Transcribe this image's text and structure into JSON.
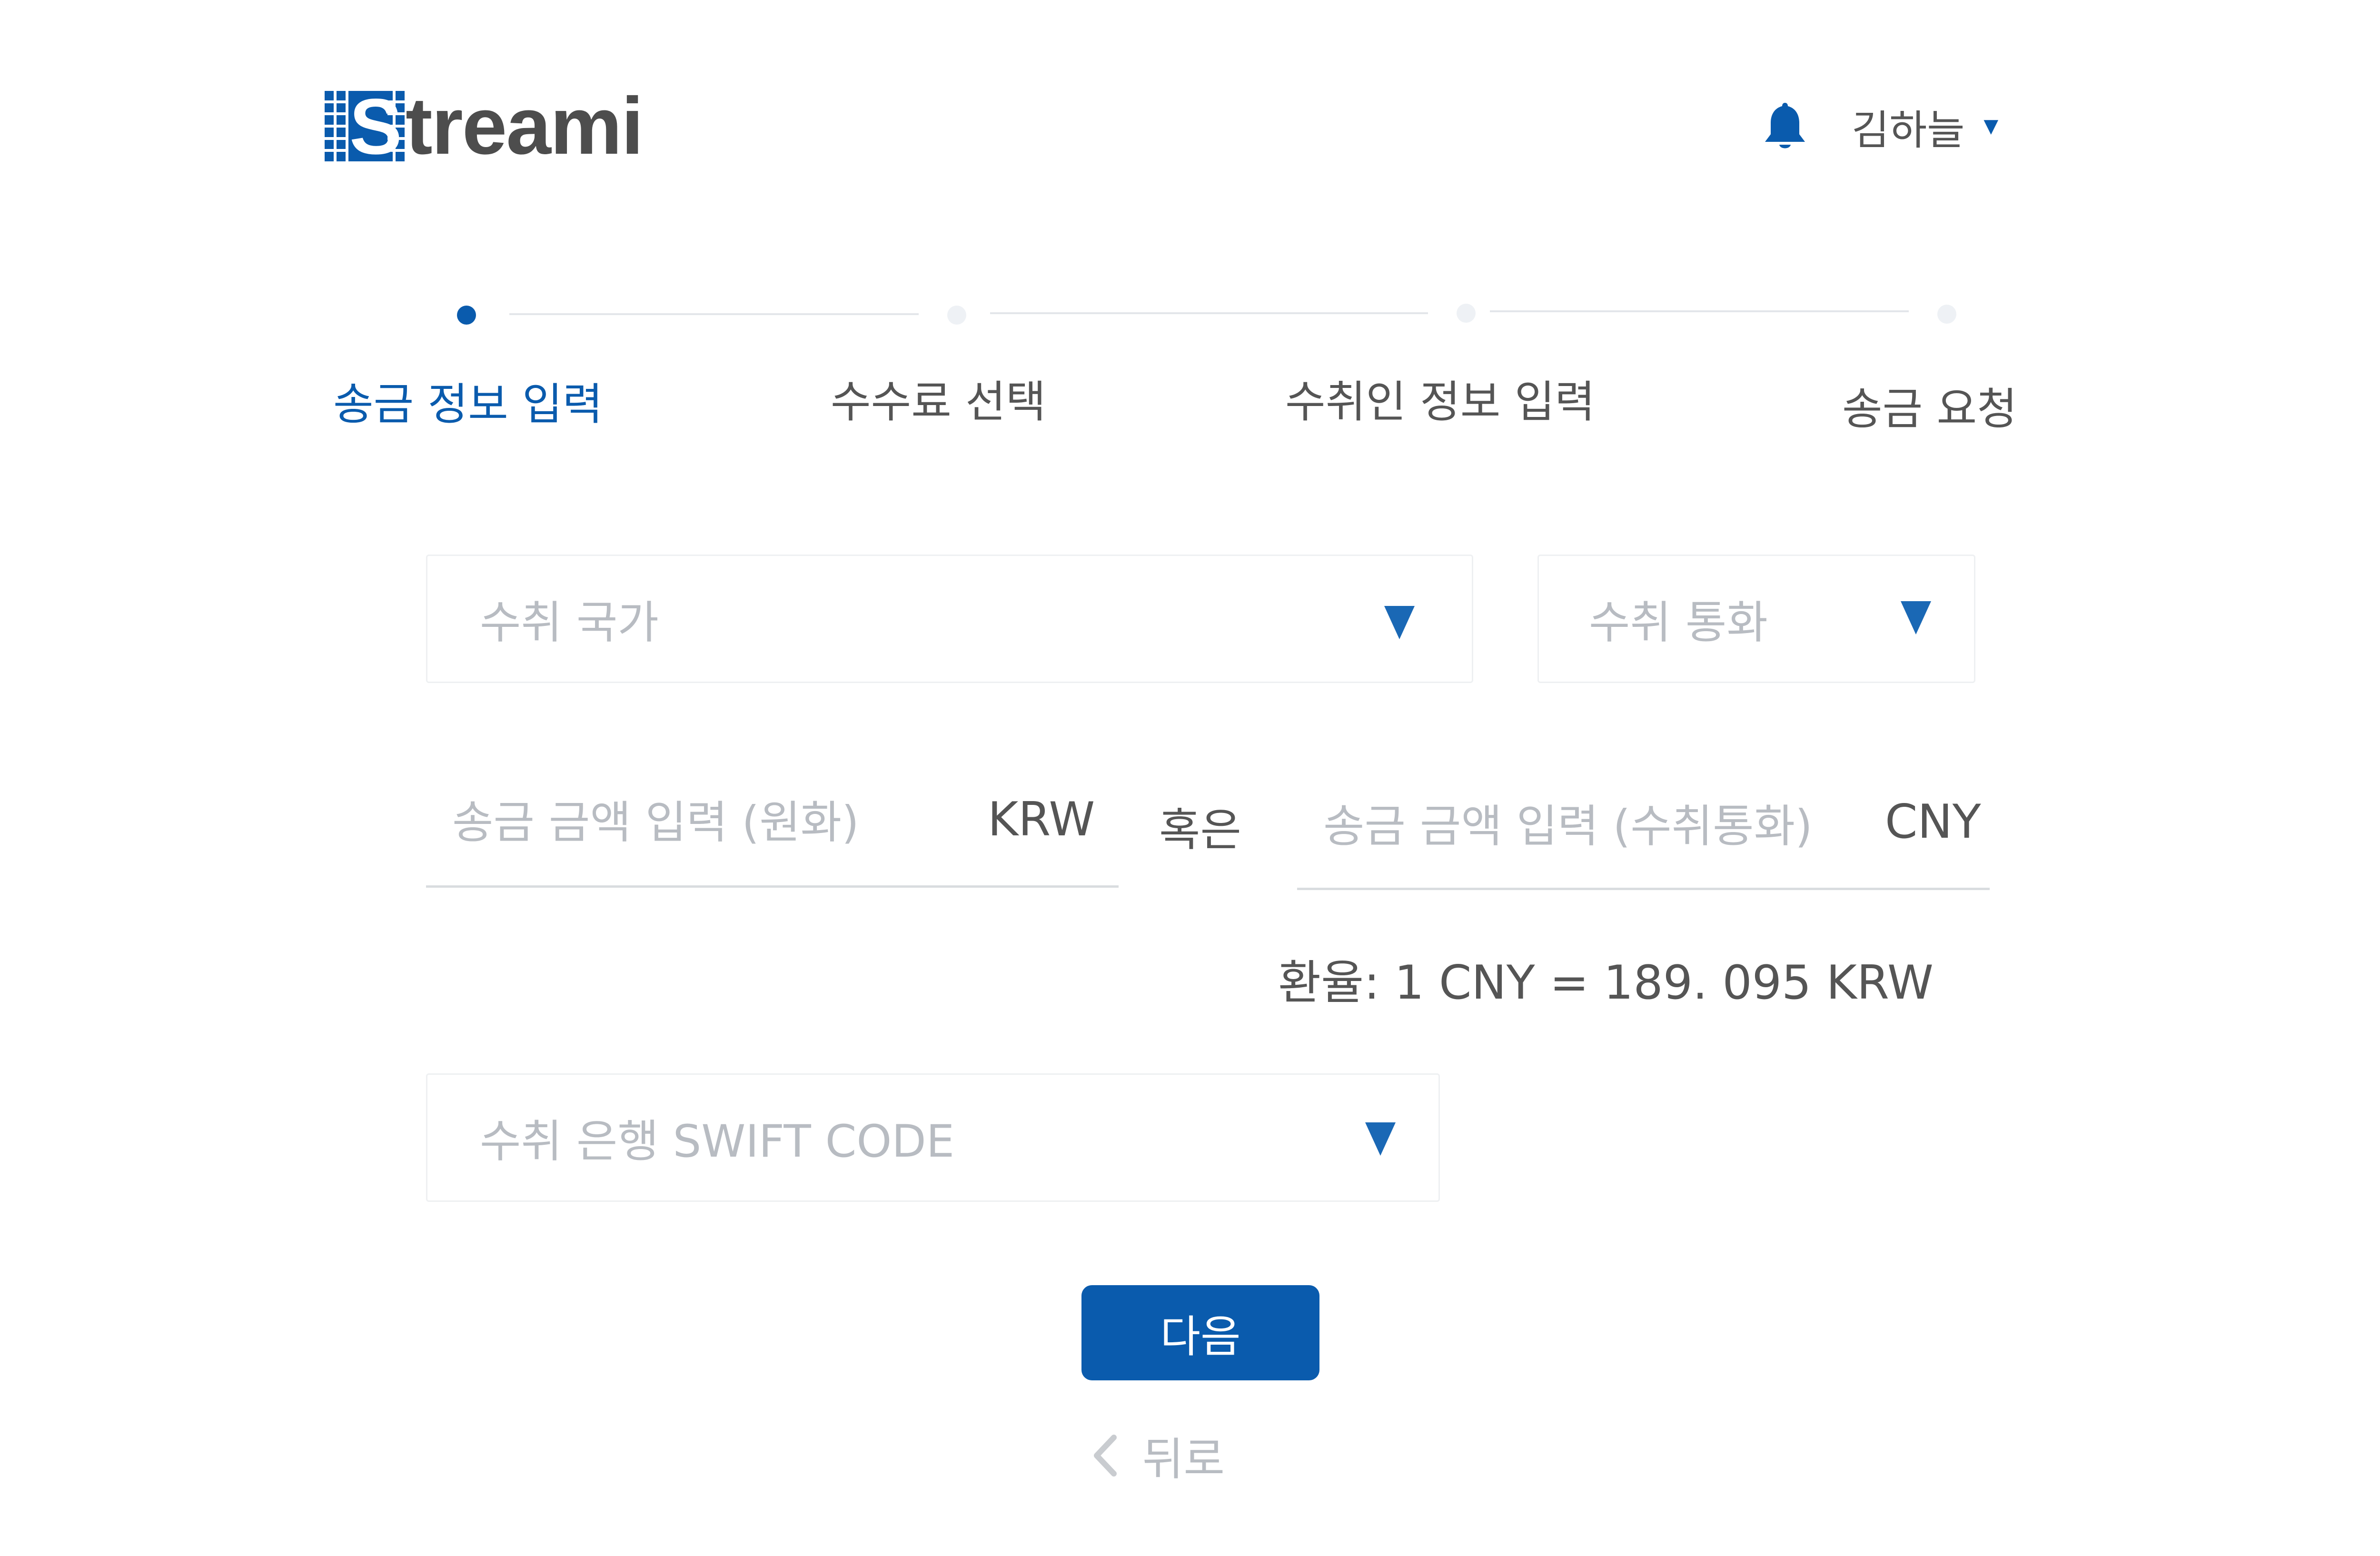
{
  "header": {
    "brand": "Streami",
    "logo_letter": "S",
    "logo_text": "treami",
    "user_name": "김하늘",
    "user_menu_caret": "▼"
  },
  "stepper": {
    "steps": [
      {
        "label": "송금 정보 입력",
        "active": true
      },
      {
        "label": "수수료 선택",
        "active": false
      },
      {
        "label": "수취인 정보 입력",
        "active": false
      },
      {
        "label": "송금 요청",
        "active": false
      }
    ]
  },
  "form": {
    "country_select": {
      "placeholder": "수취 국가"
    },
    "currency_select": {
      "placeholder": "수취 통화"
    },
    "krw_amount": {
      "placeholder": "송금 금액 입력 (원화)",
      "unit": "KRW"
    },
    "or_label": "혹은",
    "foreign_amount": {
      "placeholder": "송금 금액 입력 (수취통화)",
      "unit": "CNY"
    },
    "exchange_rate": "환율: 1 CNY = 189. 095 KRW",
    "swift_select": {
      "placeholder": "수취 은행 SWIFT CODE"
    }
  },
  "actions": {
    "next_label": "다음",
    "back_label": "뒤로"
  },
  "colors": {
    "accent": "#0a5bad",
    "placeholder": "#b8bcc2",
    "text": "#555555"
  }
}
